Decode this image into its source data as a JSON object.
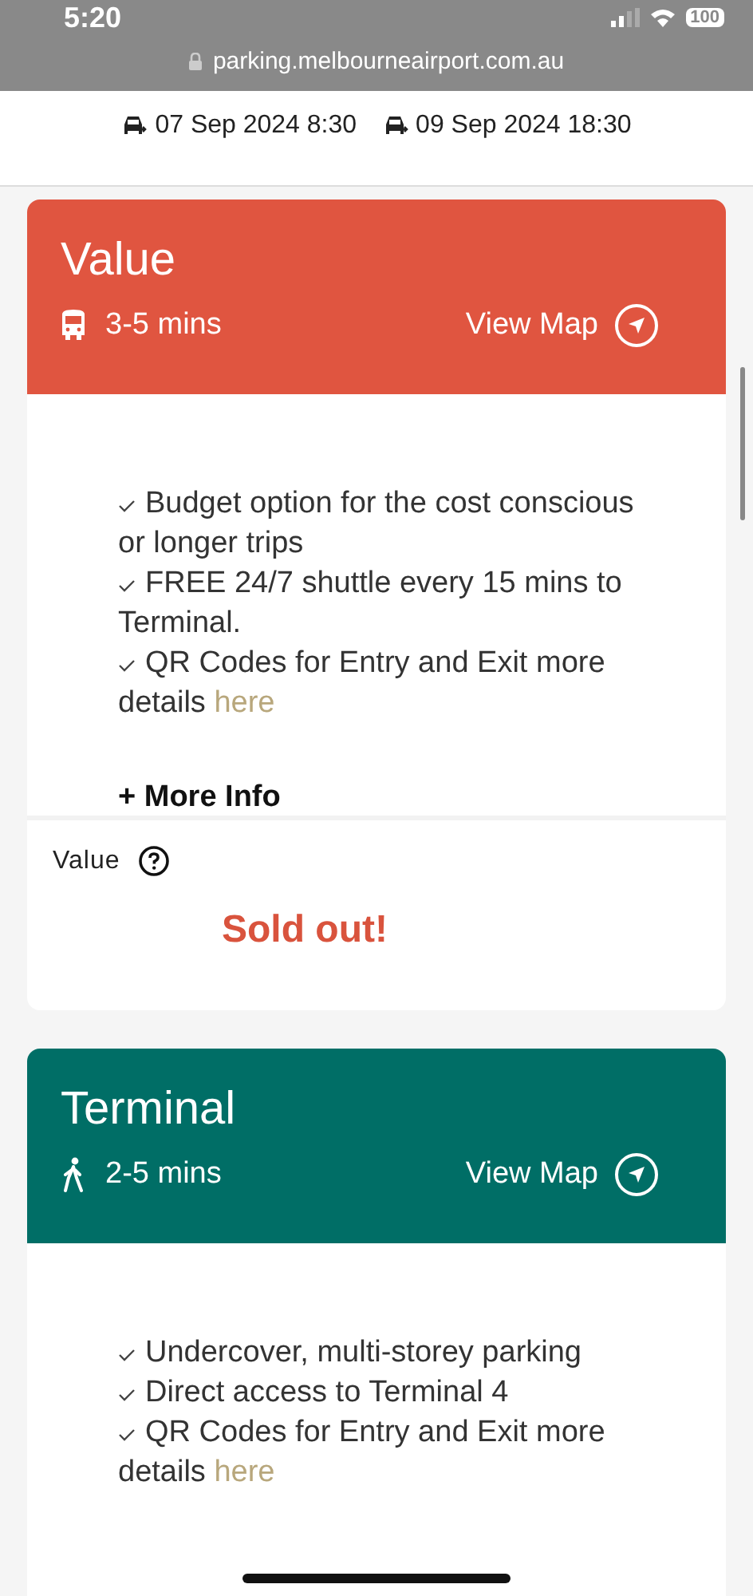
{
  "status_bar": {
    "time": "5:20",
    "battery": "100"
  },
  "url_bar": {
    "url": "parking.melbourneairport.com.au"
  },
  "dates": [
    {
      "text": "07 Sep 2024 8:30"
    },
    {
      "text": "09 Sep 2024 18:30"
    }
  ],
  "products": [
    {
      "title": "Value",
      "color": "#e05540",
      "kind": "bus",
      "duration": "3-5 mins",
      "map_link": "View Map",
      "features": [
        {
          "text": "Budget option for the cost conscious or longer trips"
        },
        {
          "text": "FREE 24/7 shuttle every 15 mins to Terminal."
        },
        {
          "text": "QR Codes for Entry and Exit more details",
          "link": "here"
        }
      ],
      "more_info": "+ More Info",
      "price_label": "Value",
      "status": "Sold out!"
    },
    {
      "title": "Terminal",
      "color": "#006e66",
      "kind": "walk",
      "duration": "2-5 mins",
      "map_link": "View Map",
      "features": [
        {
          "text": "Undercover, multi-storey parking"
        },
        {
          "text": "Direct access to Terminal 4"
        },
        {
          "text": "QR Codes for Entry and Exit more details",
          "link": "here"
        }
      ]
    }
  ]
}
